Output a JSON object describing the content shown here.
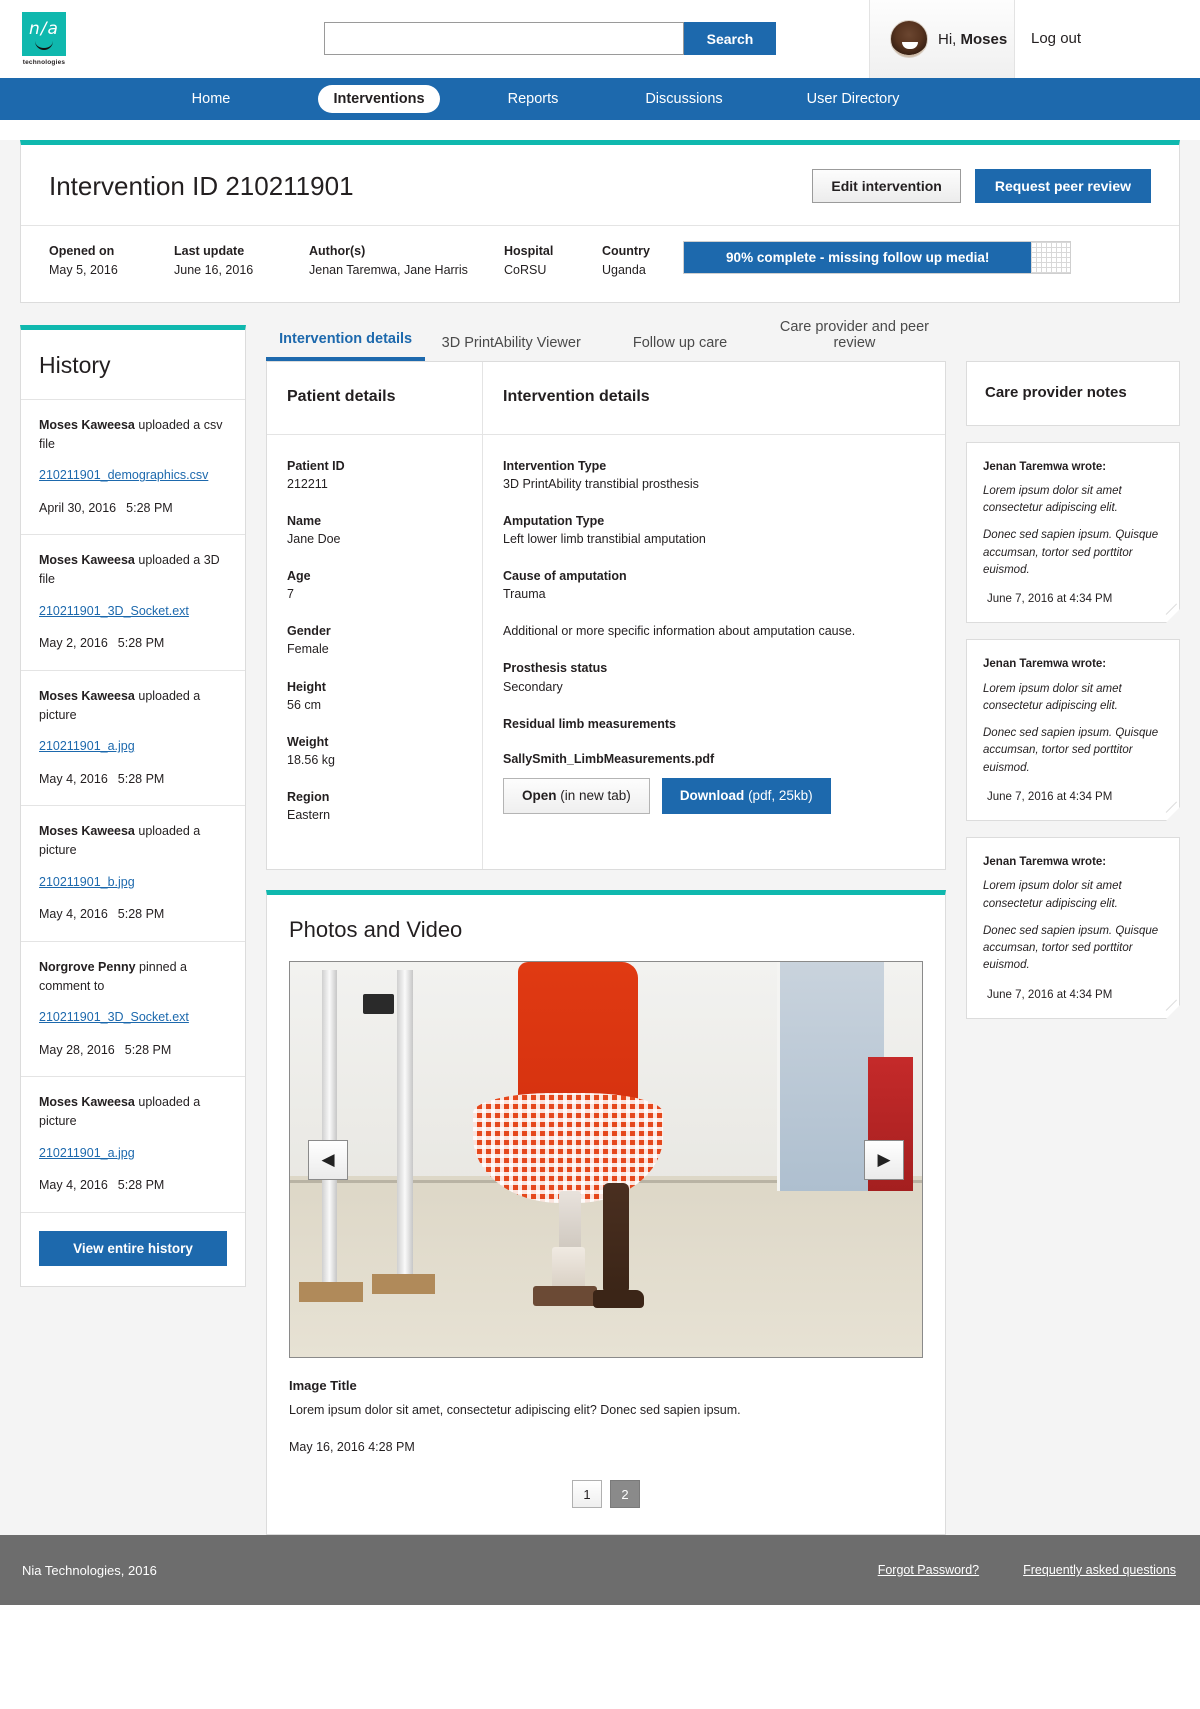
{
  "brand": {
    "logo_text": "n/a",
    "logo_sub": "technologies"
  },
  "header": {
    "search_value": "",
    "search_placeholder": "",
    "search_button": "Search",
    "greeting_prefix": "Hi, ",
    "user_name": "Moses",
    "logout": "Log out"
  },
  "nav": {
    "items": [
      {
        "label": "Home",
        "active": false
      },
      {
        "label": "Interventions",
        "active": true
      },
      {
        "label": "Reports",
        "active": false
      },
      {
        "label": "Discussions",
        "active": false
      },
      {
        "label": "User Directory",
        "active": false
      }
    ]
  },
  "intervention": {
    "title": "Intervention ID 210211901",
    "edit_button": "Edit intervention",
    "review_button": "Request peer review",
    "meta": [
      {
        "key": "Opened on",
        "value": "May 5, 2016"
      },
      {
        "key": "Last update",
        "value": "June 16, 2016"
      },
      {
        "key": "Author(s)",
        "value": "Jenan Taremwa, Jane Harris"
      },
      {
        "key": "Hospital",
        "value": "CoRSU"
      },
      {
        "key": "Country",
        "value": "Uganda"
      }
    ],
    "progress": {
      "percent": 90,
      "label": "90% complete - missing follow up media!"
    }
  },
  "history": {
    "title": "History",
    "items": [
      {
        "who": "Moses Kaweesa",
        "action": " uploaded a csv file",
        "file": "210211901_demographics.csv",
        "date": "April 30, 2016",
        "time": "5:28 PM"
      },
      {
        "who": "Moses Kaweesa",
        "action": " uploaded a 3D file",
        "file": "210211901_3D_Socket.ext",
        "date": "May 2, 2016",
        "time": "5:28 PM"
      },
      {
        "who": "Moses Kaweesa",
        "action": " uploaded a picture",
        "file": "210211901_a.jpg",
        "date": "May 4, 2016",
        "time": "5:28 PM"
      },
      {
        "who": "Moses Kaweesa",
        "action": " uploaded a picture",
        "file": "210211901_b.jpg",
        "date": "May 4, 2016",
        "time": "5:28 PM"
      },
      {
        "who": "Norgrove Penny",
        "action": " pinned a comment to",
        "file": "210211901_3D_Socket.ext",
        "date": "May 28, 2016",
        "time": "5:28 PM"
      },
      {
        "who": "Moses Kaweesa",
        "action": " uploaded a picture",
        "file": "210211901_a.jpg",
        "date": "May 4, 2016",
        "time": "5:28 PM"
      }
    ],
    "view_all_button": "View entire history"
  },
  "tabs": [
    {
      "label": "Intervention details",
      "active": true
    },
    {
      "label": "3D PrintAbility Viewer",
      "active": false
    },
    {
      "label": "Follow up care",
      "active": false
    },
    {
      "label": "Care provider and peer review",
      "active": false
    }
  ],
  "patient_details": {
    "heading": "Patient details",
    "fields": [
      {
        "key": "Patient ID",
        "value": "212211"
      },
      {
        "key": "Name",
        "value": "Jane Doe"
      },
      {
        "key": "Age",
        "value": "7"
      },
      {
        "key": "Gender",
        "value": "Female"
      },
      {
        "key": "Height",
        "value": "56 cm"
      },
      {
        "key": "Weight",
        "value": "18.56 kg"
      },
      {
        "key": "Region",
        "value": "Eastern"
      }
    ]
  },
  "intervention_details": {
    "heading": "Intervention details",
    "fields": [
      {
        "key": "Intervention Type",
        "value": "3D PrintAbility transtibial prosthesis"
      },
      {
        "key": "Amputation Type",
        "value": "Left lower limb transtibial amputation"
      },
      {
        "key": "Cause of amputation",
        "value": "Trauma"
      }
    ],
    "note": "Additional or more specific information about amputation cause.",
    "status_field": {
      "key": "Prosthesis status",
      "value": "Secondary"
    },
    "measurements_label": "Residual limb measurements",
    "pdf_name": "SallySmith_LimbMeasurements.pdf",
    "open_button_bold": "Open",
    "open_button_rest": " (in new tab)",
    "download_button_bold": "Download",
    "download_button_rest": " (pdf, 25kb)"
  },
  "notes": {
    "heading": "Care provider notes",
    "items": [
      {
        "who": "Jenan Taremwa wrote:",
        "p1": "Lorem ipsum dolor sit amet consectetur adipiscing elit.",
        "p2": "Donec sed sapien ipsum. Quisque accumsan, tortor sed porttitor euismod.",
        "when": "June 7, 2016 at 4:34 PM"
      },
      {
        "who": "Jenan Taremwa wrote:",
        "p1": "Lorem ipsum dolor sit amet consectetur adipiscing elit.",
        "p2": "Donec sed sapien ipsum. Quisque accumsan, tortor sed porttitor euismod.",
        "when": "June 7, 2016 at 4:34 PM"
      },
      {
        "who": "Jenan Taremwa wrote:",
        "p1": "Lorem ipsum dolor sit amet consectetur adipiscing elit.",
        "p2": "Donec sed sapien ipsum. Quisque accumsan, tortor sed porttitor euismod.",
        "when": "June 7, 2016 at 4:34 PM"
      }
    ]
  },
  "photos": {
    "heading": "Photos and Video",
    "prev_icon": "◀",
    "next_icon": "▶",
    "caption_title": "Image Title",
    "caption_text": "Lorem ipsum dolor sit amet, consectetur adipiscing elit? Donec sed sapien ipsum.",
    "caption_date": "May 16, 2016    4:28 PM",
    "pages": [
      {
        "label": "1",
        "active": false
      },
      {
        "label": "2",
        "active": true
      }
    ]
  },
  "footer": {
    "copyright": "Nia Technologies, 2016",
    "links": [
      "Forgot Password?",
      "Frequently asked questions"
    ]
  },
  "colors": {
    "brand_teal": "#0fb8ae",
    "brand_blue": "#1d69ad",
    "footer_gray": "#6d6d6d"
  }
}
